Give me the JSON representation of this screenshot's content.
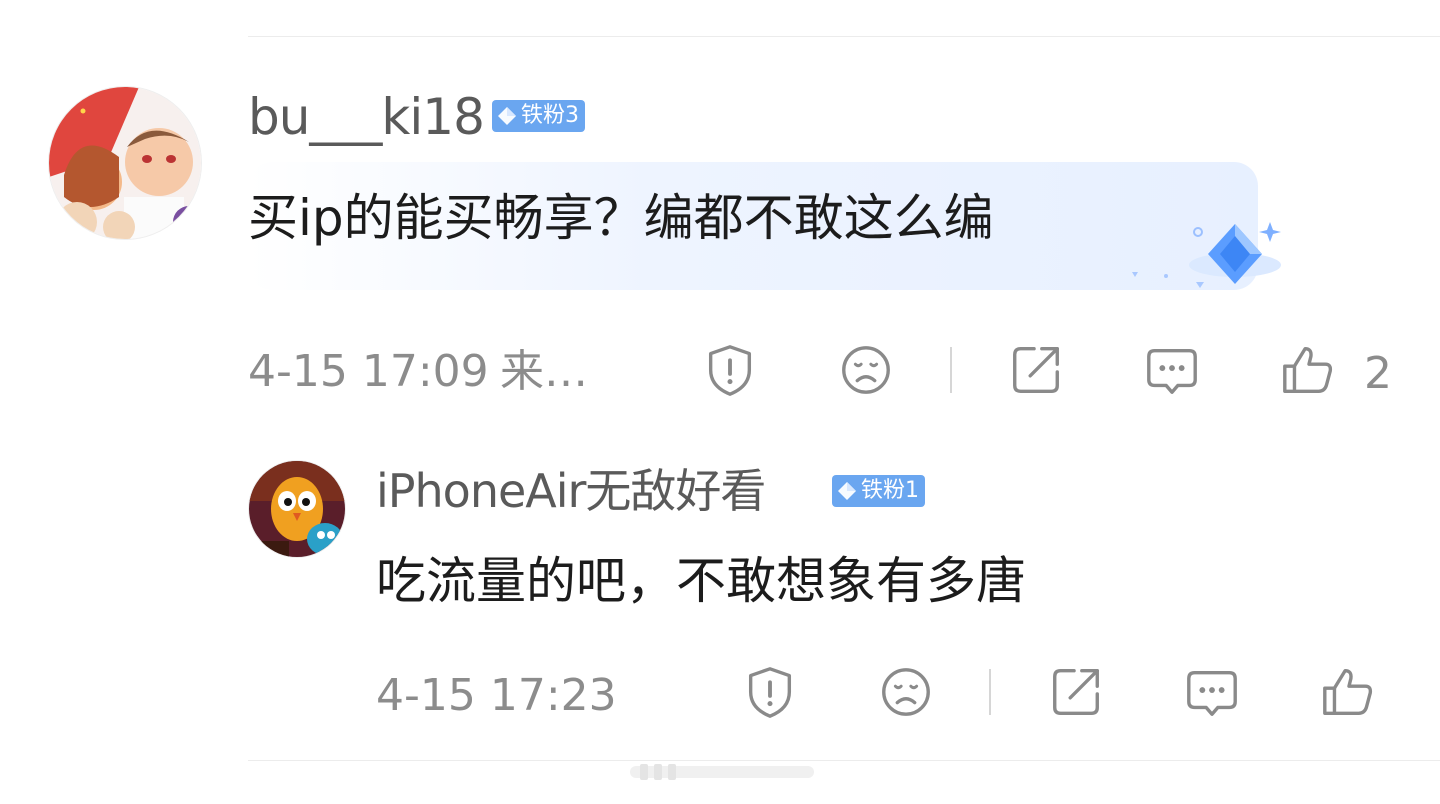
{
  "comments": [
    {
      "username": "bu___ki18",
      "badge": "铁粉3",
      "text": "买ip的能买畅享？编都不敢这么编",
      "time": "4-15 17:09",
      "source": "来…",
      "likes": "2"
    },
    {
      "username": "iPhoneAir无敌好看",
      "badge": "铁粉1",
      "text": "吃流量的吧，不敢想象有多唐",
      "time": "4-15 17:23"
    }
  ],
  "icons": [
    "report-icon",
    "dislike-icon",
    "share-icon",
    "reply-icon",
    "like-icon",
    "diamond-sticker-icon"
  ],
  "colors": {
    "badge": "#6aa6f0",
    "bubble": "#eef4ff",
    "muted_text": "#8c8c8c",
    "icon_gray": "#8a8a8a"
  }
}
